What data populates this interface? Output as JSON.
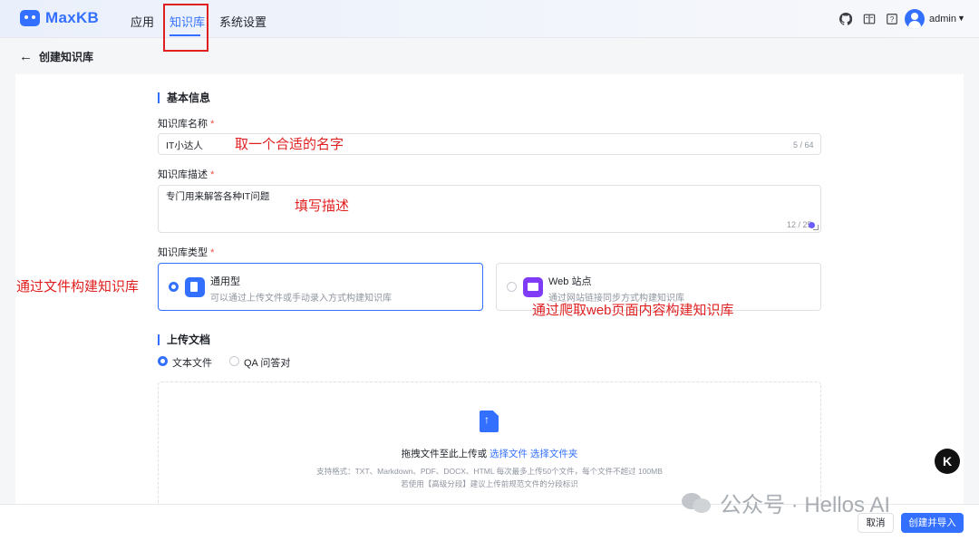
{
  "header": {
    "logo": "MaxKB",
    "nav": [
      "应用",
      "知识库",
      "系统设置"
    ],
    "user": "admin",
    "icons": [
      "github-icon",
      "book-icon",
      "help-icon",
      "user-avatar-icon",
      "chevron-down-icon"
    ]
  },
  "page": {
    "back_icon": "arrow-left-icon",
    "title": "创建知识库"
  },
  "basic": {
    "section_title": "基本信息",
    "name_label": "知识库名称",
    "name_value": "IT小达人",
    "name_counter": "5 / 64",
    "desc_label": "知识库描述",
    "desc_value": "专门用来解答各种IT问题",
    "desc_counter": "12 / 25",
    "required_mark": "*",
    "type_label": "知识库类型",
    "types": [
      {
        "title": "通用型",
        "desc": "可以通过上传文件或手动录入方式构建知识库",
        "selected": true,
        "icon": "document-icon"
      },
      {
        "title": "Web 站点",
        "desc": "通过网站链接同步方式构建知识库",
        "selected": false,
        "icon": "web-icon"
      }
    ]
  },
  "upload": {
    "section_title": "上传文档",
    "modes": [
      {
        "label": "文本文件",
        "selected": true
      },
      {
        "label": "QA 问答对",
        "selected": false
      }
    ],
    "drop_text": "拖拽文件至此上传或",
    "choose_file": "选择文件",
    "choose_folder": "选择文件夹",
    "hint1": "支持格式：TXT、Markdown、PDF、DOCX、HTML 每次最多上传50个文件，每个文件不超过 100MB",
    "hint2": "若使用【高级分段】建议上传前规范文件的分段标识",
    "icon": "upload-file-icon"
  },
  "footer": {
    "cancel": "取消",
    "create": "创建并导入"
  },
  "annotations": {
    "name": "取一个合适的名字",
    "desc": "填写描述",
    "file": "通过文件构建知识库",
    "web": "通过爬取web页面内容构建知识库"
  },
  "watermark": "公众号 · Hellos AI",
  "floating_badge": "K",
  "colors": {
    "accent": "#3370ff",
    "annotation": "#e02020",
    "purple": "#7f3bf5"
  }
}
